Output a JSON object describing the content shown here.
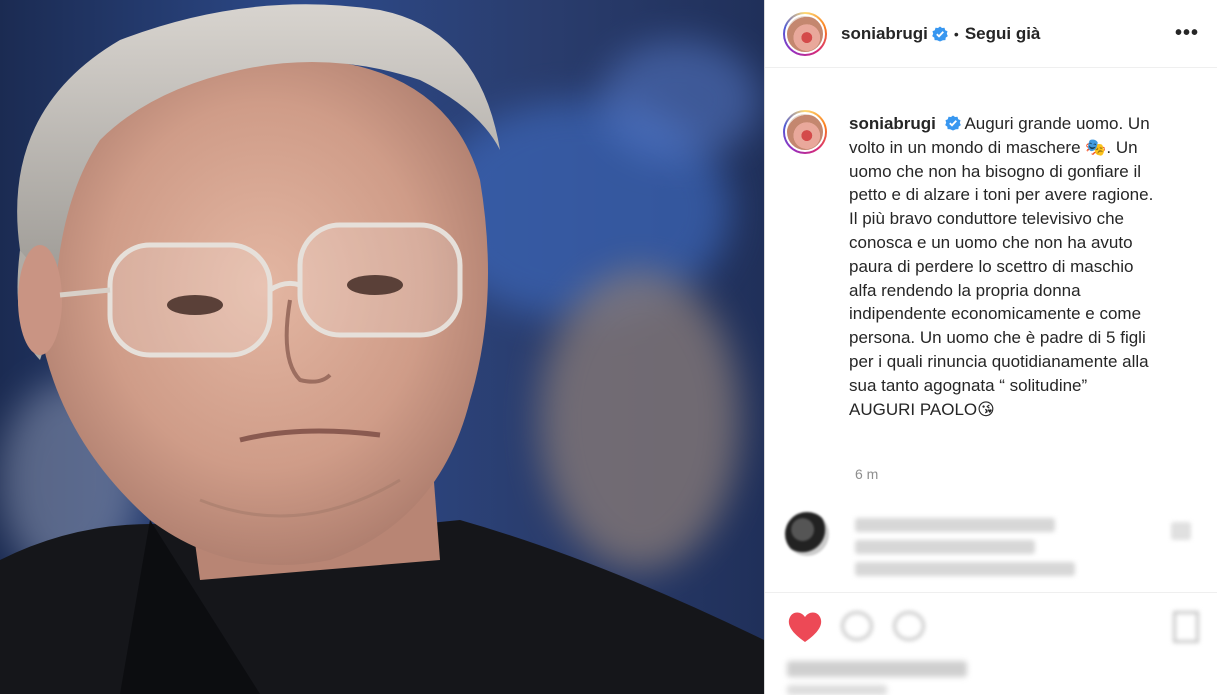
{
  "post": {
    "username": "soniabrugi",
    "follow_status": "Segui già",
    "dot": "•",
    "more_label": "•••"
  },
  "caption": {
    "username": "soniabrugi",
    "text": "Auguri grande uomo. Un volto in un mondo di maschere 🎭. Un uomo che non ha bisogno di gonfiare il petto e di alzare i toni per avere ragione. Il più bravo conduttore televisivo che conosca e un uomo che non ha avuto paura di perdere lo scettro di maschio alfa rendendo la propria donna indipendente economicamente e come persona. Un uomo che è padre di 5 figli per i quali rinuncia quotidianamente alla sua tanto agognata “ solitudine” AUGURI PAOLO😘",
    "time": "6 m"
  },
  "colors": {
    "verified": "#3897f0",
    "heart": "#ed4956",
    "text": "#262626",
    "muted": "#8e8e8e"
  }
}
